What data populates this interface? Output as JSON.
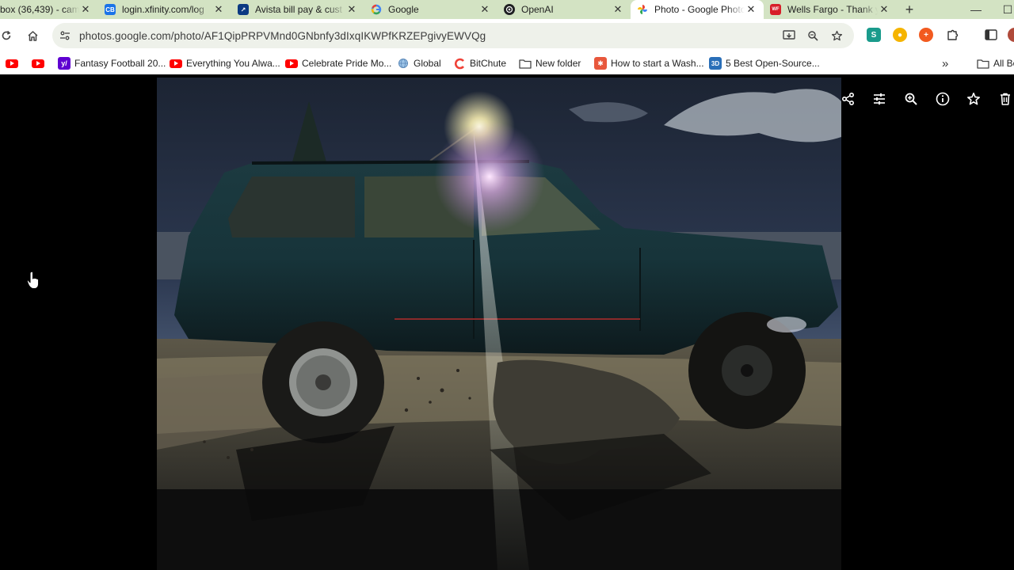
{
  "tabs": [
    {
      "title": "box (36,439) - cam",
      "favicon": "gmail-icon",
      "color": "#c5221f",
      "glyph": ""
    },
    {
      "title": "login.xfinity.com/log",
      "favicon": "cb-icon",
      "color": "#1a73e8",
      "glyph": "CB"
    },
    {
      "title": "Avista bill pay & cust",
      "favicon": "avista-icon",
      "color": "#0b3a82",
      "glyph": "↗"
    },
    {
      "title": "Google",
      "favicon": "google-icon",
      "color": "#ffffff",
      "glyph": "G"
    },
    {
      "title": "OpenAI",
      "favicon": "openai-icon",
      "color": "#202123",
      "glyph": "❀"
    },
    {
      "title": "Photo - Google Photos",
      "favicon": "google-photos-icon",
      "color": "#ffffff",
      "glyph": "✸"
    },
    {
      "title": "Wells Fargo - Thank you",
      "favicon": "wells-fargo-icon",
      "color": "#d71e28",
      "glyph": "WF"
    }
  ],
  "active_tab": 5,
  "address_bar": {
    "url": "photos.google.com/photo/AF1QipPRPVMnd0GNbnfy3dIxqIKWPfKRZEPgivyEWVQg"
  },
  "bookmarks": [
    {
      "label": "",
      "icon": "youtube-icon"
    },
    {
      "label": "",
      "icon": "youtube-icon"
    },
    {
      "label": "Fantasy Football 20...",
      "icon": "yahoo-icon"
    },
    {
      "label": "Everything You Alwa...",
      "icon": "youtube-icon"
    },
    {
      "label": "Celebrate Pride Mo...",
      "icon": "youtube-icon"
    },
    {
      "label": "Global",
      "icon": "globe-icon"
    },
    {
      "label": "BitChute",
      "icon": "bitchute-icon"
    },
    {
      "label": "New folder",
      "icon": "folder-icon"
    },
    {
      "label": "How to start a Wash...",
      "icon": "wikihow-icon"
    },
    {
      "label": "5 Best Open-Source...",
      "icon": "3d-icon"
    }
  ],
  "bookmarks_overflow": "»",
  "all_bookmarks_label": "All Bo",
  "viewer_tools": [
    "share-icon",
    "edit-icon",
    "zoom-icon",
    "info-icon",
    "favorite-icon",
    "delete-icon"
  ],
  "colors": {
    "tab_strip": "#d3e3c3",
    "omnibox": "#eef1ea"
  }
}
